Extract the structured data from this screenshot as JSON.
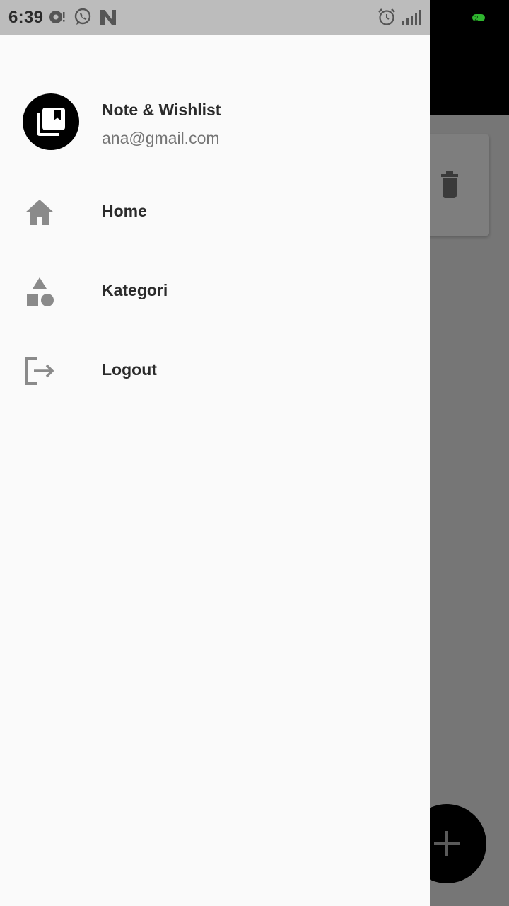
{
  "status_bar": {
    "time": "6:39",
    "icons": [
      "sync-icon",
      "whatsapp-icon",
      "n-app-icon",
      "alarm-icon",
      "signal-icon",
      "battery-icon"
    ]
  },
  "drawer": {
    "header": {
      "app_name": "Note & Wishlist",
      "email": "ana@gmail.com",
      "avatar_icon": "collections-bookmark-icon"
    },
    "items": [
      {
        "label": "Home",
        "icon": "home-icon"
      },
      {
        "label": "Kategori",
        "icon": "category-icon"
      },
      {
        "label": "Logout",
        "icon": "logout-icon"
      }
    ]
  },
  "background": {
    "appbar_color": "#000000",
    "scrim_color": "#767676",
    "card_icon": "delete-icon",
    "fab_icon": "add-icon"
  },
  "colors": {
    "drawer_bg": "#fafafa",
    "icon_gray": "#8a8a8a",
    "text_primary": "#2b2b2b",
    "text_secondary": "#757575"
  }
}
